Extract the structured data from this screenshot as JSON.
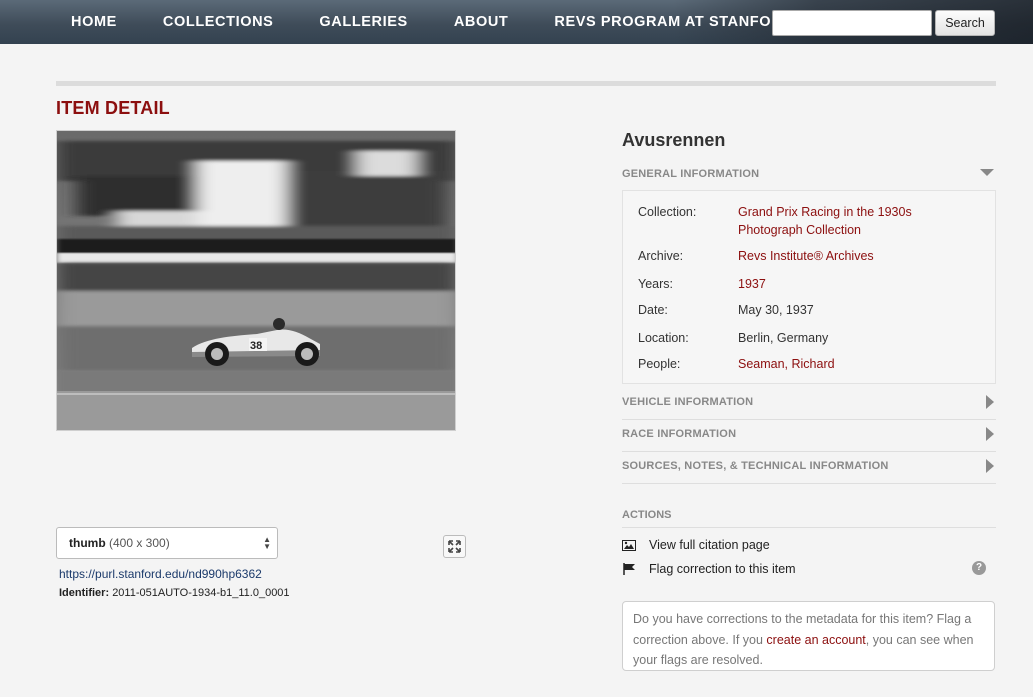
{
  "nav": {
    "items": [
      "HOME",
      "COLLECTIONS",
      "GALLERIES",
      "ABOUT",
      "REVS PROGRAM AT STANFORD"
    ],
    "search_value": "",
    "search_button": "Search"
  },
  "page_title": "ITEM DETAIL",
  "image": {
    "size_option": "thumb",
    "size_dims": "(400 x 300)",
    "purl": "https://purl.stanford.edu/nd990hp6362",
    "identifier_label": "Identifier:",
    "identifier_value": "2011-051AUTO-1934-b1_11.0_0001",
    "car_number": "38"
  },
  "item": {
    "title": "Avusrennen",
    "sections": {
      "general": "GENERAL INFORMATION",
      "vehicle": "VEHICLE INFORMATION",
      "race": "RACE INFORMATION",
      "sources": "SOURCES, NOTES, & TECHNICAL INFORMATION"
    },
    "general": {
      "collection_label": "Collection:",
      "collection_value": "Grand Prix Racing in the 1930s Photograph Collection",
      "archive_label": "Archive:",
      "archive_value": "Revs Institute® Archives",
      "years_label": "Years:",
      "years_value": "1937",
      "date_label": "Date:",
      "date_value": "May 30, 1937",
      "location_label": "Location:",
      "location_value": "Berlin, Germany",
      "people_label": "People:",
      "people_value": "Seaman, Richard"
    }
  },
  "actions": {
    "header": "ACTIONS",
    "view_citation": "View full citation page",
    "flag_correction": "Flag correction to this item",
    "help": "?"
  },
  "note": {
    "part1": "Do you have corrections to the metadata for this item? Flag a correction above. If you ",
    "link": "create an account",
    "part2": ", you can see when your flags are resolved."
  },
  "colors": {
    "accent": "#8c0f0f",
    "nav_bg": "#3f4c59"
  }
}
